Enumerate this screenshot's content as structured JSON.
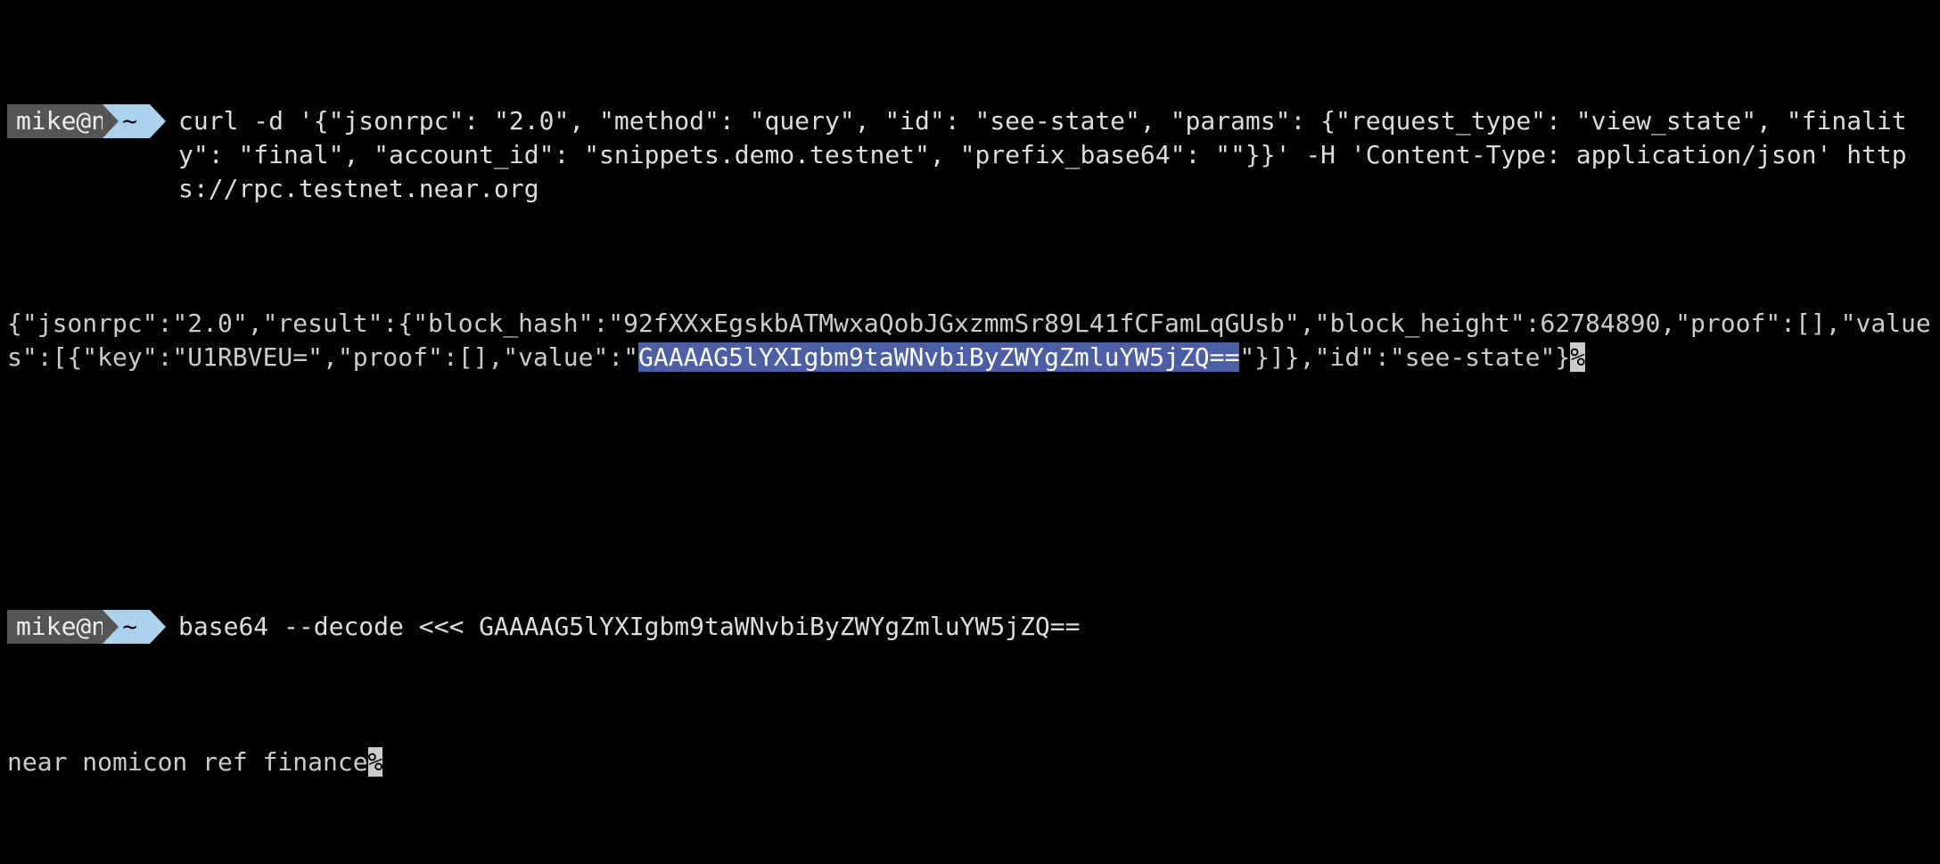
{
  "prompt": {
    "user": " mike@n ",
    "path": "~"
  },
  "block1": {
    "command": "curl -d '{\"jsonrpc\": \"2.0\", \"method\": \"query\", \"id\": \"see-state\", \"params\": {\"request_type\": \"view_state\", \"finality\": \"final\", \"account_id\": \"snippets.demo.testnet\", \"prefix_base64\": \"\"}}' -H 'Content-Type: application/json' https://rpc.testnet.near.org",
    "response_pre": "{\"jsonrpc\":\"2.0\",\"result\":{\"block_hash\":\"92fXXxEgskbATMwxaQobJGxzmmSr89L41fCFamLqGUsb\",\"block_height\":62784890,\"proof\":[],\"values\":[{\"key\":\"U1RBVEU=\",\"proof\":[],\"value\":\"",
    "response_highlight": "GAAAAG5lYXIgbm9taWNvbiByZWYgZmluYW5jZQ==",
    "response_post": "\"}]},\"id\":\"see-state\"}",
    "eol_marker": "%"
  },
  "block2": {
    "command": "base64 --decode <<< GAAAAG5lYXIgbm9taWNvbiByZWYgZmluYW5jZQ==",
    "output": "near nomicon ref finance",
    "eol_marker": "%"
  }
}
